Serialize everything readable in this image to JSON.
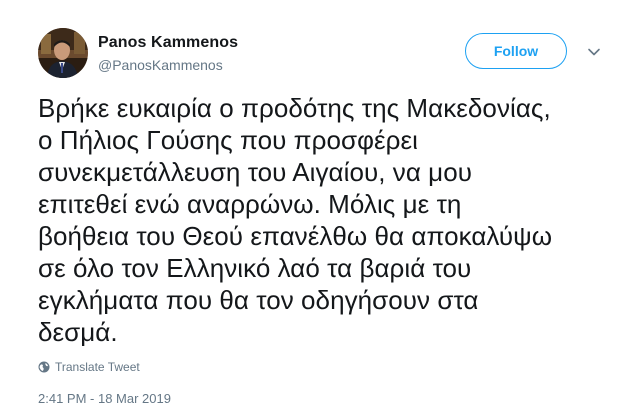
{
  "author": {
    "name": "Panos Kammenos",
    "handle": "@PanosKammenos",
    "avatar_icon": "profile-photo"
  },
  "actions": {
    "follow_label": "Follow",
    "menu_icon": "chevron-down-icon"
  },
  "tweet": {
    "lines": [
      "Βρήκε ευκαιρία ο προδότης της Μακεδονίας,",
      "ο Πήλιος Γούσης που προσφέρει",
      "συνεκμετάλλευση του Αιγαίου, να μου",
      "επιτεθεί ενώ αναρρώνω. Μόλις με τη",
      "βοήθεια του Θεού επανέλθω θα αποκαλύψω",
      "σε όλο τον Ελληνικό λαό τα βαριά του",
      "εγκλήματα που θα τον οδηγήσουν στα",
      "δεσμά."
    ],
    "translate_label": "Translate Tweet",
    "timestamp": "2:41 PM - 18 Mar 2019"
  },
  "colors": {
    "accent": "#1da1f2",
    "secondary_text": "#657786",
    "primary_text": "#14171a"
  }
}
